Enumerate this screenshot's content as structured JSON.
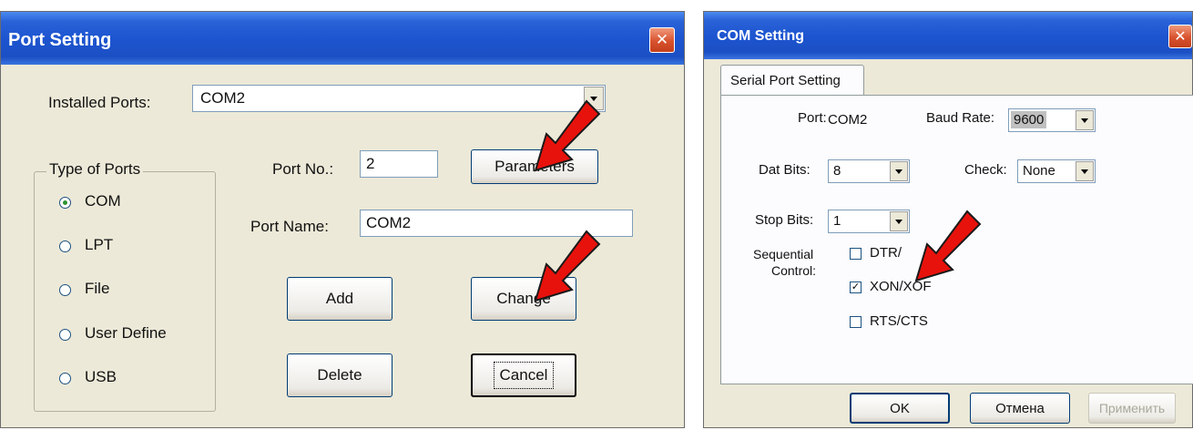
{
  "port_setting": {
    "title": "Port Setting",
    "installed_ports_label": "Installed Ports:",
    "installed_ports_value": "COM2",
    "type_of_ports_label": "Type of Ports",
    "port_types": [
      {
        "label": "COM",
        "selected": true
      },
      {
        "label": "LPT",
        "selected": false
      },
      {
        "label": "File",
        "selected": false
      },
      {
        "label": "User Define",
        "selected": false
      },
      {
        "label": "USB",
        "selected": false
      }
    ],
    "port_no_label": "Port No.:",
    "port_no_value": "2",
    "parameters_button": "Parameters",
    "port_name_label": "Port Name:",
    "port_name_value": "COM2",
    "add_button": "Add",
    "change_button": "Change",
    "delete_button": "Delete",
    "cancel_button": "Cancel"
  },
  "com_setting": {
    "title": "COM Setting",
    "tab_label": "Serial Port Setting",
    "port_label": "Port:",
    "port_value": "COM2",
    "baud_rate_label": "Baud Rate:",
    "baud_rate_value": "9600",
    "dat_bits_label": "Dat Bits:",
    "dat_bits_value": "8",
    "check_label": "Check:",
    "check_value": "None",
    "stop_bits_label": "Stop Bits:",
    "stop_bits_value": "1",
    "sequential_label_1": "Sequential",
    "sequential_label_2": "Control:",
    "flow_options": [
      {
        "label": "DTR/",
        "checked": false
      },
      {
        "label": "XON/XOF",
        "checked": true
      },
      {
        "label": "RTS/CTS",
        "checked": false
      }
    ],
    "ok_button": "OK",
    "cancel_button": "Отмена",
    "apply_button": "Применить"
  },
  "close_glyph": "✕",
  "colors": {
    "title_bar": "#1d55d0",
    "dialog_bg": "#ece9d8",
    "close_button": "#d8522e",
    "annotation_arrow": "#e8120c"
  }
}
